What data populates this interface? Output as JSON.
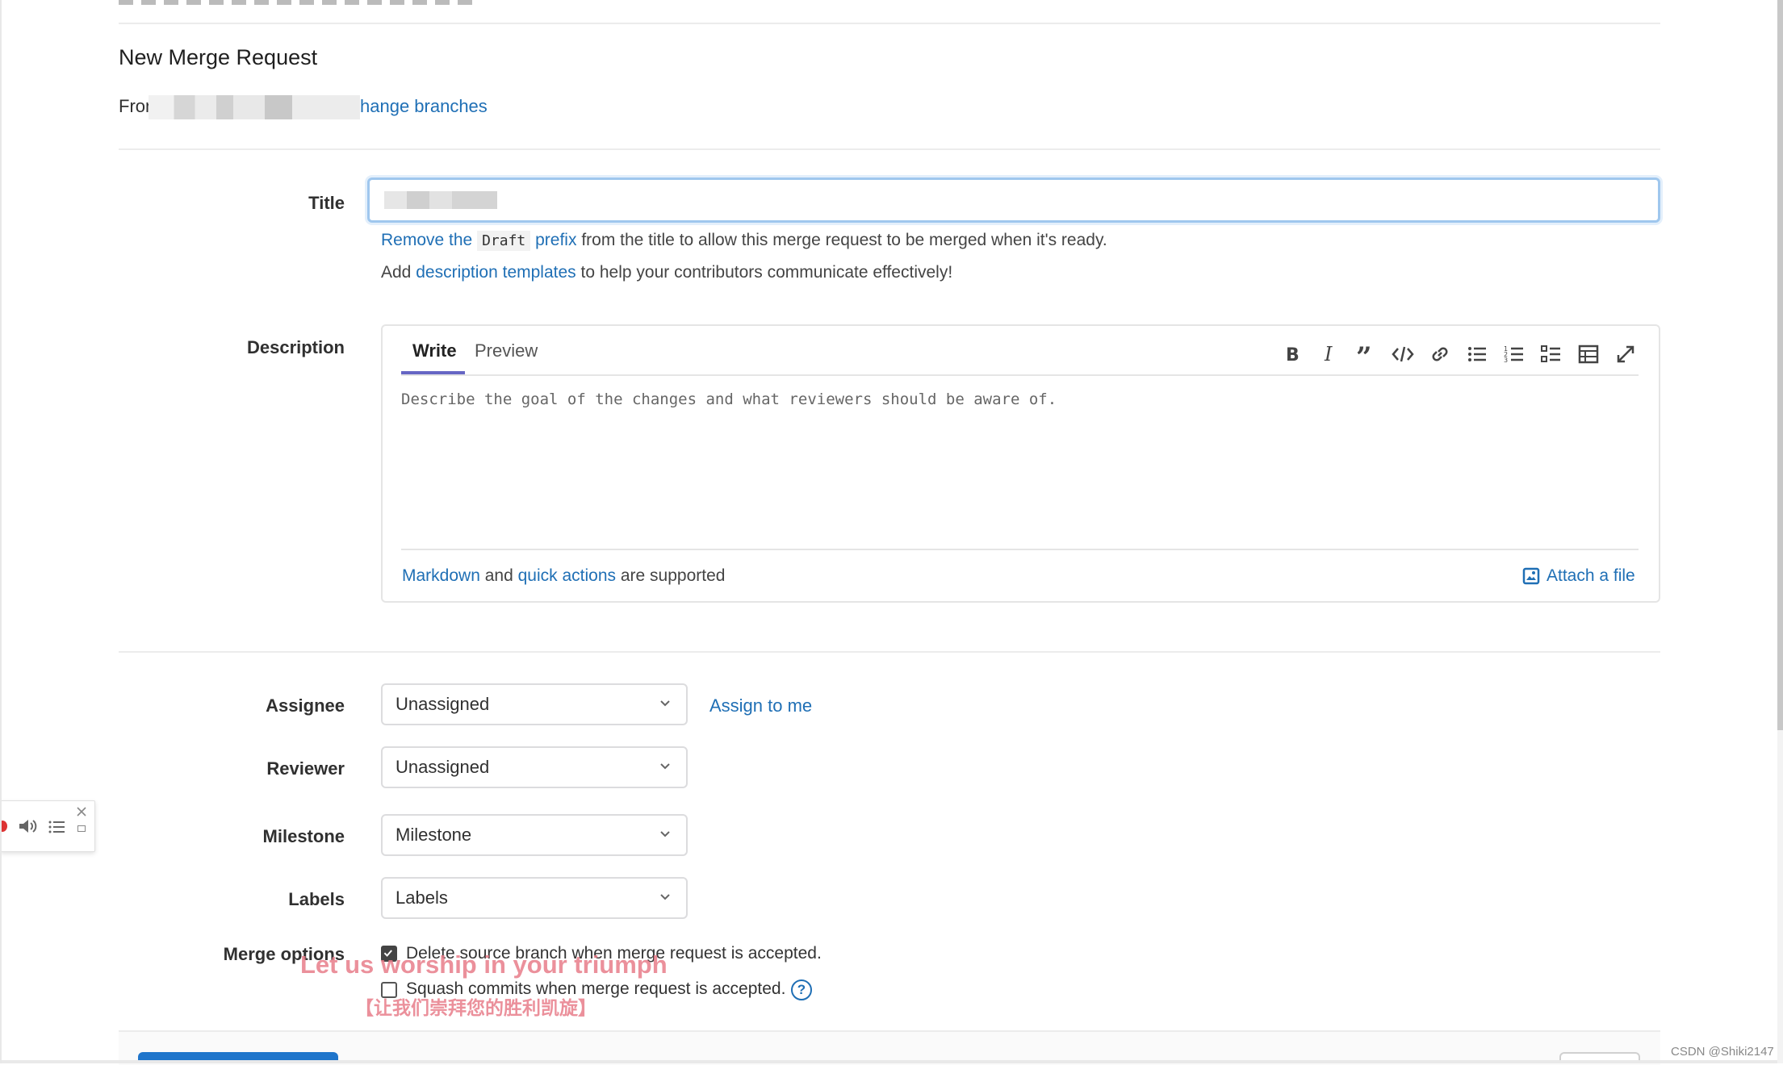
{
  "header": {
    "title": "New Merge Request",
    "from_prefix": "Fron",
    "change_branches_link": "hange branches"
  },
  "title_field": {
    "label": "Title",
    "hint_remove": "Remove the",
    "hint_draft": "Draft",
    "hint_prefix": "prefix",
    "hint_rest": "from the title to allow this merge request to be merged when it's ready.",
    "hint_add": "Add",
    "hint_templates": "description templates",
    "hint_templates_rest": "to help your contributors communicate effectively!"
  },
  "description": {
    "label": "Description",
    "tab_write": "Write",
    "tab_preview": "Preview",
    "placeholder": "Describe the goal of the changes and what reviewers should be aware of.",
    "footer_markdown": "Markdown",
    "footer_and": "and",
    "footer_quick_actions": "quick actions",
    "footer_supported": "are supported",
    "attach_file": "Attach a file",
    "toolbar_icons": [
      "bold-icon",
      "italic-icon",
      "quote-icon",
      "code-icon",
      "link-icon",
      "bullet-list-icon",
      "numbered-list-icon",
      "task-list-icon",
      "table-icon",
      "fullscreen-icon"
    ]
  },
  "assignee": {
    "label": "Assignee",
    "value": "Unassigned",
    "assign_to_me": "Assign to me"
  },
  "reviewer": {
    "label": "Reviewer",
    "value": "Unassigned"
  },
  "milestone": {
    "label": "Milestone",
    "value": "Milestone"
  },
  "labels": {
    "label": "Labels",
    "value": "Labels"
  },
  "merge_options": {
    "label": "Merge options",
    "delete_source": "Delete source branch when merge request is accepted.",
    "delete_source_checked": true,
    "squash": "Squash commits when merge request is accepted.",
    "squash_checked": false
  },
  "overlay": {
    "lyric_en": "Let us worship in your triumph",
    "lyric_zh": "【让我们崇拜您的胜利凯旋】"
  },
  "watermark": "CSDN @Shiki2147",
  "colors": {
    "link": "#1f6fb5",
    "tab_active": "#6666c4",
    "focus": "#c9e0f7",
    "primary": "#1f75cb",
    "overlay_text": "#e87c8a"
  }
}
